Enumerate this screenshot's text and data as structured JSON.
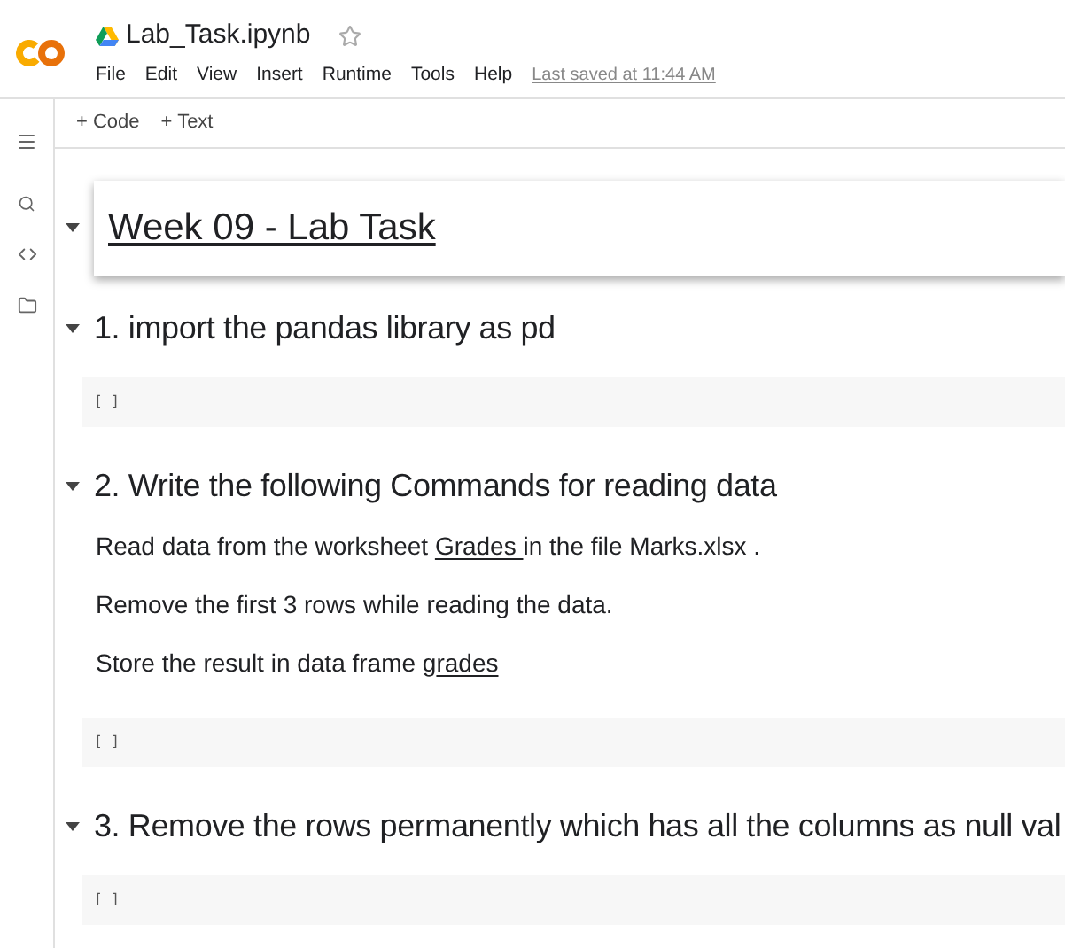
{
  "header": {
    "file_name": "Lab_Task.ipynb",
    "starred": false,
    "menu": [
      "File",
      "Edit",
      "View",
      "Insert",
      "Runtime",
      "Tools",
      "Help"
    ],
    "last_saved": "Last saved at 11:44 AM"
  },
  "toolbar": [
    "+ Code",
    "+ Text"
  ],
  "cells": [
    {
      "kind": "title",
      "text": "Week 09 - Lab Task",
      "underlined": true,
      "selected": true,
      "expanded": true
    },
    {
      "kind": "heading",
      "text": "1. import the pandas library as pd",
      "underlined": false,
      "selected": false,
      "expanded": true
    },
    {
      "kind": "code",
      "prompt": "[ ]"
    },
    {
      "kind": "heading",
      "text": "2. Write the following Commands for reading data",
      "underlined": false,
      "selected": false,
      "expanded": true
    },
    {
      "kind": "text",
      "paragraphs": [
        [
          {
            "text": "Read data from the worksheet ",
            "underlined": false
          },
          {
            "text": "Grades ",
            "underlined": true
          },
          {
            "text": "in the file Marks.xlsx .",
            "underlined": false
          }
        ],
        [
          {
            "text": "Remove the first 3 rows while reading the data.",
            "underlined": false
          }
        ],
        [
          {
            "text": "Store the result in data frame g",
            "underlined": false
          },
          {
            "text": "rades",
            "underlined": true
          }
        ]
      ]
    },
    {
      "kind": "code",
      "prompt": "[ ]"
    },
    {
      "kind": "heading",
      "text": "3. Remove the rows permanently which has all the columns as null val",
      "underlined": false,
      "selected": false,
      "expanded": true
    },
    {
      "kind": "code",
      "prompt": "[ ]"
    }
  ]
}
